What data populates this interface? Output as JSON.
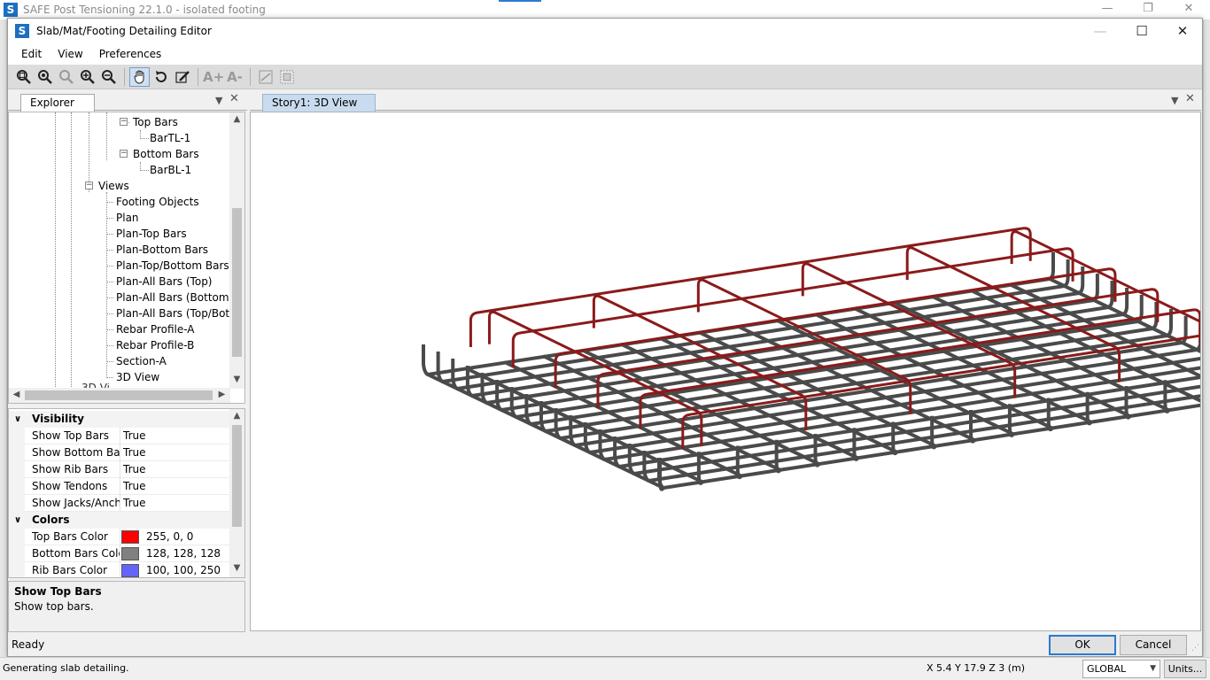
{
  "app": {
    "title": "SAFE Post Tensioning 22.1.0 - isolated footing",
    "logo": "S"
  },
  "dialog": {
    "title": "Slab/Mat/Footing Detailing Editor",
    "logo": "S"
  },
  "menu": {
    "items": [
      "Edit",
      "View",
      "Preferences"
    ]
  },
  "toolbar": {
    "buttons": [
      "zoom-window-icon",
      "zoom-restore-icon",
      "zoom-previous-icon",
      "zoom-in-icon",
      "zoom-out-icon",
      "pan-icon",
      "rotate-icon",
      "edit-pencil-icon"
    ],
    "font_larger": "A+",
    "font_smaller": "A-",
    "extra": [
      "display-options-icon",
      "grid-icon"
    ]
  },
  "explorer": {
    "tab_label": "Explorer",
    "tree": [
      {
        "label": "Top Bars",
        "level": 4,
        "expander": "−"
      },
      {
        "label": "BarTL-1",
        "level": 5
      },
      {
        "label": "Bottom Bars",
        "level": 4,
        "expander": "−"
      },
      {
        "label": "BarBL-1",
        "level": 5
      },
      {
        "label": "Views",
        "level": 2,
        "expander": "−"
      },
      {
        "label": "Footing Objects",
        "level": 3
      },
      {
        "label": "Plan",
        "level": 3
      },
      {
        "label": "Plan-Top Bars",
        "level": 3
      },
      {
        "label": "Plan-Bottom Bars",
        "level": 3
      },
      {
        "label": "Plan-Top/Bottom Bars",
        "level": 3
      },
      {
        "label": "Plan-All Bars (Top)",
        "level": 3
      },
      {
        "label": "Plan-All Bars (Bottom)",
        "level": 3
      },
      {
        "label": "Plan-All Bars (Top/Botto",
        "level": 3
      },
      {
        "label": "Rebar Profile-A",
        "level": 3
      },
      {
        "label": "Rebar Profile-B",
        "level": 3
      },
      {
        "label": "Section-A",
        "level": 3
      },
      {
        "label": "3D View",
        "level": 3
      }
    ],
    "partial_item": "3D Vi"
  },
  "properties": {
    "categories": [
      {
        "name": "Visibility",
        "rows": [
          {
            "name": "Show Top Bars",
            "value": "True"
          },
          {
            "name": "Show Bottom Bars",
            "value": "True"
          },
          {
            "name": "Show Rib Bars",
            "value": "True"
          },
          {
            "name": "Show Tendons",
            "value": "True"
          },
          {
            "name": "Show Jacks/Anchors",
            "value": "True"
          }
        ]
      },
      {
        "name": "Colors",
        "rows": [
          {
            "name": "Top Bars Color",
            "value": "255, 0, 0",
            "color": "#ff0000"
          },
          {
            "name": "Bottom Bars Color",
            "value": "128, 128, 128",
            "color": "#808080"
          },
          {
            "name": "Rib Bars Color",
            "value": "100, 100, 250",
            "color": "#6464fa"
          }
        ]
      }
    ],
    "help_title": "Show Top Bars",
    "help_desc": "Show top bars."
  },
  "view": {
    "tab_label": "Story1: 3D View",
    "top_bar_color": "#8b1a1a",
    "bottom_bar_color": "#4a4a4a"
  },
  "footer": {
    "status": "Ready",
    "ok_label": "OK",
    "cancel_label": "Cancel"
  },
  "appstatus": {
    "message": "Generating slab detailing.",
    "coords": "X 5.4  Y 17.9  Z 3 (m)",
    "coord_system": "GLOBAL",
    "units_label": "Units..."
  }
}
